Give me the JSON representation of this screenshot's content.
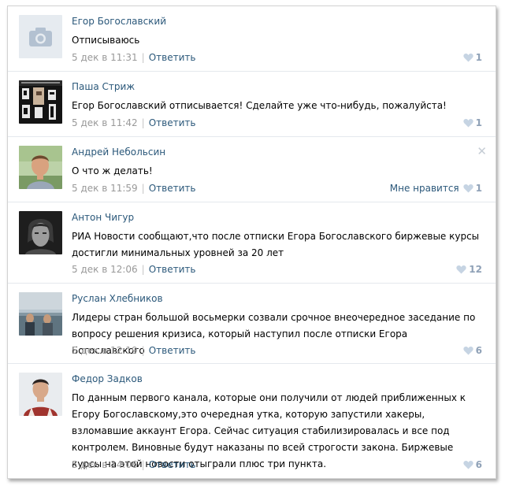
{
  "reply_label": "Ответить",
  "like_label": "Мне нравится",
  "colors": {
    "link": "#2b587a",
    "meta": "#999999",
    "heart": "#c6d4e3"
  },
  "comments": [
    {
      "author": "Егор Богославский",
      "text": "Отписываюсь",
      "time": "5 дек в 11:31",
      "likes": "1"
    },
    {
      "author": "Паша Стриж",
      "text": "Егор Богославский отписывается! Сделайте уже что-нибудь, пожалуйста!",
      "time": "5 дек в 11:42",
      "likes": "1"
    },
    {
      "author": "Андрей Небольсин",
      "text": "О что ж делать!",
      "time": "5 дек в 11:59",
      "likes": "1"
    },
    {
      "author": "Антон Чигур",
      "text": "РИА Новости сообщают,что после отписки Егора Богославского биржевые курсы достигли минимальных уровней за 20 лет",
      "time": "5 дек в 12:06",
      "likes": "12"
    },
    {
      "author": "Руслан Хлебников",
      "text": "Лидеры стран большой восьмерки созвали срочное внеочередное заседание по вопросу решения кризиса, который наступил после отписки Егора Богославского",
      "time": "5 дек в 12:19",
      "likes": "6"
    },
    {
      "author": "Федор Задков",
      "text": "По данным первого канала, которые они получили от людей приближенных к Егору Богославскому,это очередная утка, которую запустили хакеры, взломавшие аккаунт Егора. Сейчас ситуация стабилизировалась и все под контролем. Виновные будут наказаны по всей строгости закона. Биржевые курсы на этой новости отыграли плюс три пункта.",
      "time": "5 дек в 14:06",
      "likes": "6"
    }
  ]
}
